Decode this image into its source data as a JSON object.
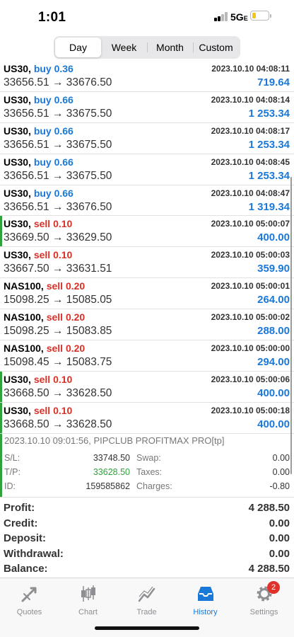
{
  "status_bar": {
    "time": "1:01",
    "network": "5G",
    "network_suffix": "E"
  },
  "periods": {
    "options": [
      "Day",
      "Week",
      "Month",
      "Custom"
    ],
    "selected": "Day"
  },
  "deals": [
    {
      "symbol": "US30,",
      "side": "buy",
      "volume": "0.36",
      "time": "2023.10.10 04:08:11",
      "price_open": "33656.51",
      "price_close": "33676.50",
      "profit": "719.64",
      "flagged": false
    },
    {
      "symbol": "US30,",
      "side": "buy",
      "volume": "0.66",
      "time": "2023.10.10 04:08:14",
      "price_open": "33656.51",
      "price_close": "33675.50",
      "profit": "1 253.34",
      "flagged": false
    },
    {
      "symbol": "US30,",
      "side": "buy",
      "volume": "0.66",
      "time": "2023.10.10 04:08:17",
      "price_open": "33656.51",
      "price_close": "33675.50",
      "profit": "1 253.34",
      "flagged": false
    },
    {
      "symbol": "US30,",
      "side": "buy",
      "volume": "0.66",
      "time": "2023.10.10 04:08:45",
      "price_open": "33656.51",
      "price_close": "33675.50",
      "profit": "1 253.34",
      "flagged": false
    },
    {
      "symbol": "US30,",
      "side": "buy",
      "volume": "0.66",
      "time": "2023.10.10 04:08:47",
      "price_open": "33656.51",
      "price_close": "33676.50",
      "profit": "1 319.34",
      "flagged": false
    },
    {
      "symbol": "US30,",
      "side": "sell",
      "volume": "0.10",
      "time": "2023.10.10 05:00:07",
      "price_open": "33669.50",
      "price_close": "33629.50",
      "profit": "400.00",
      "flagged": true
    },
    {
      "symbol": "US30,",
      "side": "sell",
      "volume": "0.10",
      "time": "2023.10.10 05:00:03",
      "price_open": "33667.50",
      "price_close": "33631.51",
      "profit": "359.90",
      "flagged": false
    },
    {
      "symbol": "NAS100,",
      "side": "sell",
      "volume": "0.20",
      "time": "2023.10.10 05:00:01",
      "price_open": "15098.25",
      "price_close": "15085.05",
      "profit": "264.00",
      "flagged": false
    },
    {
      "symbol": "NAS100,",
      "side": "sell",
      "volume": "0.20",
      "time": "2023.10.10 05:00:02",
      "price_open": "15098.25",
      "price_close": "15083.85",
      "profit": "288.00",
      "flagged": false
    },
    {
      "symbol": "NAS100,",
      "side": "sell",
      "volume": "0.20",
      "time": "2023.10.10 05:00:00",
      "price_open": "15098.45",
      "price_close": "15083.75",
      "profit": "294.00",
      "flagged": false
    },
    {
      "symbol": "US30,",
      "side": "sell",
      "volume": "0.10",
      "time": "2023.10.10 05:00:06",
      "price_open": "33668.50",
      "price_close": "33628.50",
      "profit": "400.00",
      "flagged": true
    },
    {
      "symbol": "US30,",
      "side": "sell",
      "volume": "0.10",
      "time": "2023.10.10 05:00:18",
      "price_open": "33668.50",
      "price_close": "33628.50",
      "profit": "400.00",
      "flagged": true
    }
  ],
  "arrow": "→",
  "detail": {
    "comment": "2023.10.10 09:01:56, PIPCLUB PROFITMAX PRO[tp]",
    "sl_label": "S/L:",
    "sl_value": "33748.50",
    "tp_label": "T/P:",
    "tp_value": "33628.50",
    "id_label": "ID:",
    "id_value": "159585862",
    "swap_label": "Swap:",
    "swap_value": "0.00",
    "taxes_label": "Taxes:",
    "taxes_value": "0.00",
    "charges_label": "Charges:",
    "charges_value": "-0.80"
  },
  "summary": [
    {
      "label": "Profit:",
      "value": "4 288.50"
    },
    {
      "label": "Credit:",
      "value": "0.00"
    },
    {
      "label": "Deposit:",
      "value": "0.00"
    },
    {
      "label": "Withdrawal:",
      "value": "0.00"
    },
    {
      "label": "Balance:",
      "value": "4 288.50"
    }
  ],
  "tabs": [
    {
      "label": "Quotes",
      "icon": "quotes-icon"
    },
    {
      "label": "Chart",
      "icon": "chart-icon"
    },
    {
      "label": "Trade",
      "icon": "trade-icon"
    },
    {
      "label": "History",
      "icon": "history-icon",
      "active": true
    },
    {
      "label": "Settings",
      "icon": "settings-icon",
      "badge": "2"
    }
  ],
  "colors": {
    "buy": "#1a78d8",
    "sell": "#d93027",
    "profit": "#1a78d8",
    "flag": "#2fa23a",
    "active_tab": "#1a78d8",
    "badge": "#e0312b"
  }
}
